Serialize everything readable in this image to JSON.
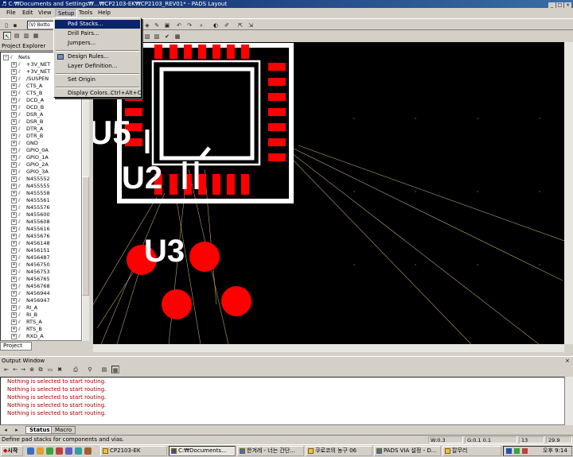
{
  "window": {
    "title": "♬ C:₩Documents and Settings₩...₩CP2103-EK₩CP2103_REV01* - PADS Layout",
    "controls": [
      "_",
      "□",
      "×"
    ]
  },
  "menu": {
    "items": [
      "File",
      "Edit",
      "View",
      "Setup",
      "Tools",
      "Help"
    ],
    "active": "Setup"
  },
  "toolbar": {
    "layer_select": "(V) Botto"
  },
  "setup_menu": {
    "items": [
      {
        "label": "Pad Stacks...",
        "shortcut": "",
        "highlighted": true
      },
      {
        "label": "Drill Pairs...",
        "shortcut": ""
      },
      {
        "label": "Jumpers...",
        "shortcut": ""
      },
      {
        "label": "Design Rules...",
        "shortcut": ""
      },
      {
        "label": "Layer Definition...",
        "shortcut": ""
      },
      {
        "label": "Set Origin",
        "shortcut": ""
      },
      {
        "label": "Display Colors...",
        "shortcut": "Ctrl+Alt+C"
      }
    ]
  },
  "project_explorer": {
    "title": "Project Explorer",
    "root": "Nets",
    "nets": [
      "+3V_NET",
      "+3V_NET",
      "/SUSPEN",
      "CTS_A",
      "CTS_B",
      "DCD_A",
      "DCD_B",
      "DSR_A",
      "DSR_B",
      "DTR_A",
      "DTR_B",
      "GND",
      "GPIO_0A",
      "GPIO_1A",
      "GPIO_2A",
      "GPIO_3A",
      "N455552",
      "N455555",
      "N455558",
      "N455561",
      "N455576",
      "N455600",
      "N455608",
      "N455616",
      "N455676",
      "N456148",
      "N456151",
      "N456487",
      "N456750",
      "N456753",
      "N456765",
      "N456768",
      "N456944",
      "N456947",
      "RI_A",
      "RI_B",
      "RTS_A",
      "RTS_B",
      "RXD_A"
    ],
    "tab": "Project"
  },
  "canvas": {
    "labels": [
      "U5",
      "U2",
      "U3"
    ],
    "colors": {
      "background": "#000000",
      "pad": "#ff0000",
      "silk": "#ffffff",
      "trace": "#b8a070"
    }
  },
  "output_window": {
    "title": "Output Window",
    "lines": [
      "Nothing is selected to start routing.",
      "Nothing is selected to start routing.",
      "Nothing is selected to start routing.",
      "Nothing is selected to start routing.",
      "Nothing is selected to start routing."
    ],
    "tabs": [
      "Status",
      "Macro"
    ],
    "active_tab": "Status"
  },
  "statusbar": {
    "text": "Define pad stacks for components and vias.",
    "width": "W:0.3",
    "grid": "G:0.1 0.1",
    "coord_x": "13",
    "coord_y": "29.9"
  },
  "taskbar": {
    "start": "시작",
    "tasks": [
      "CP2103-EK",
      "C:₩Documents...",
      "한겨레 - 너는 간단...",
      "쿠로코의 농구 06",
      "PADS VIA 설정 - D...",
      "칼무리"
    ],
    "active_task": 1,
    "clock": "오후 9:14"
  }
}
